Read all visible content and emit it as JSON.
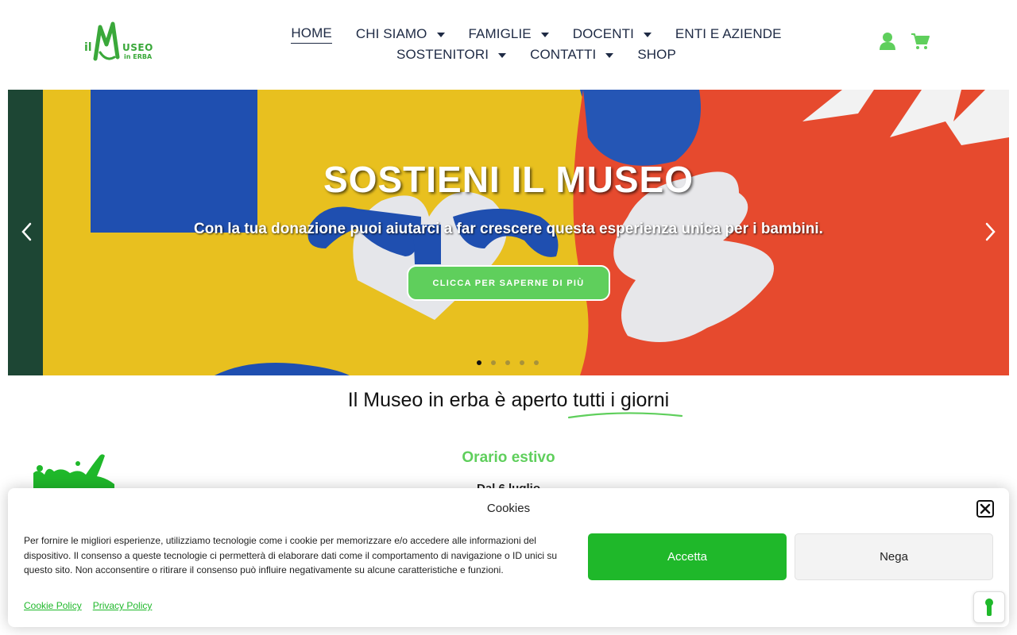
{
  "header": {
    "logo_text_top": "il",
    "logo_text_main": "MUSEO",
    "logo_text_sub": "in ERBA",
    "nav_row1": [
      {
        "label": "HOME",
        "dropdown": false,
        "active": true
      },
      {
        "label": "CHI SIAMO",
        "dropdown": true
      },
      {
        "label": "FAMIGLIE",
        "dropdown": true
      },
      {
        "label": "DOCENTI",
        "dropdown": true
      },
      {
        "label": "ENTI E AZIENDE",
        "dropdown": false
      }
    ],
    "nav_row2": [
      {
        "label": "SOSTENITORI",
        "dropdown": true
      },
      {
        "label": "CONTATTI",
        "dropdown": true
      },
      {
        "label": "SHOP",
        "dropdown": false
      }
    ],
    "icons": [
      "user-icon",
      "cart-icon"
    ],
    "accent_color": "#5fcf5c"
  },
  "hero": {
    "title": "SOSTIENI IL MUSEO",
    "subtitle": "Con la tua donazione puoi aiutarci a far crescere questa esperienza unica per i bambini.",
    "button_label": "CLICCA PER SAPERNE DI PIÙ",
    "slide_count": 5,
    "active_slide": 1
  },
  "content": {
    "headline_part1": "Il Museo in erba è aperto ",
    "headline_part2": "tutti i giorni",
    "section_title": "Orario estivo",
    "date_line": "Dal 6 luglio"
  },
  "cookie_banner": {
    "title": "Cookies",
    "text": "Per fornire le migliori esperienze, utilizziamo tecnologie come i cookie per memorizzare e/o accedere alle informazioni del dispositivo. Il consenso a queste tecnologie ci permetterà di elaborare dati come il comportamento di navigazione o ID unici su questo sito. Non acconsentire o ritirare il consenso può influire negativamente su alcune caratteristiche e funzioni.",
    "accept_label": "Accetta",
    "deny_label": "Nega",
    "link_cookie_policy": "Cookie Policy",
    "link_privacy_policy": "Privacy Policy",
    "accept_color": "#1fb82a"
  }
}
